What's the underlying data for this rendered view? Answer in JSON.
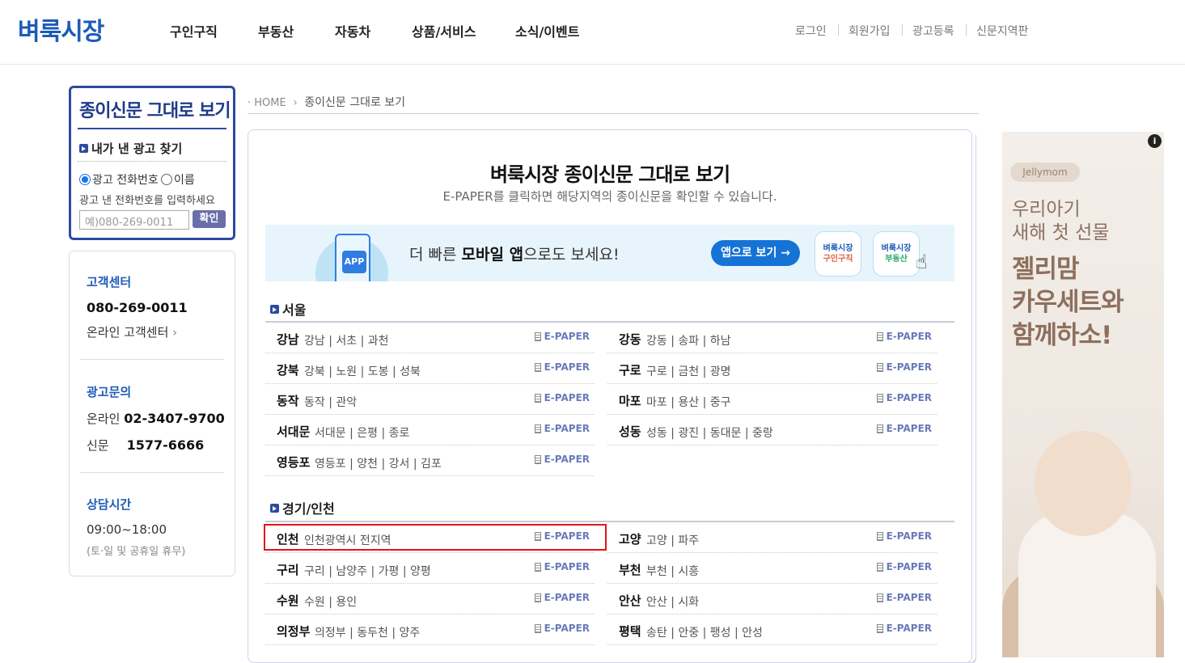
{
  "header": {
    "logo": "벼룩시장",
    "nav": [
      "구인구직",
      "부동산",
      "자동차",
      "상품/서비스",
      "소식/이벤트"
    ],
    "util": [
      "로그인",
      "회원가입",
      "광고등록",
      "신문지역판"
    ]
  },
  "paper_search": {
    "title": "종이신문 그대로 보기",
    "find_label": "내가 낸 광고 찾기",
    "radio_phone": "광고 전화번호",
    "radio_name": "이름",
    "hint": "광고 낸 전화번호를 입력하세요",
    "placeholder": "예)080-269-0011",
    "confirm": "확인"
  },
  "customer_center": {
    "cs_head": "고객센터",
    "cs_phone": "080-269-0011",
    "cs_online": "온라인 고객센터",
    "ad_head": "광고문의",
    "ad_online_label": "온라인",
    "ad_online_phone": "02-3407-9700",
    "ad_paper_label": "신문",
    "ad_paper_phone": "1577-6666",
    "hours_head": "상담시간",
    "hours": "09:00~18:00",
    "hours_note": "(토·일 및 공휴일 휴무)"
  },
  "breadcrumb": {
    "home": "HOME",
    "current": "종이신문 그대로 보기"
  },
  "main": {
    "title": "벼룩시장 종이신문 그대로 보기",
    "subtitle": "E-PAPER를 클릭하면 해당지역의 종이신문을 확인할 수 있습니다.",
    "banner": {
      "app_icon": "APP",
      "text_pre": "더 빠른 ",
      "text_bold": "모바일 앱",
      "text_post": "으로도 보세요!",
      "button": "앱으로 보기 →",
      "tile1_top": "벼룩시장",
      "tile1_bottom": "구인구직",
      "tile2_top": "벼룩시장",
      "tile2_bottom": "부동산"
    },
    "epaper_label": "E-PAPER",
    "regions": [
      {
        "name": "서울",
        "left": [
          {
            "name": "강남",
            "areas": "강남 | 서초 | 과천"
          },
          {
            "name": "강북",
            "areas": "강북 | 노원 | 도봉 | 성북"
          },
          {
            "name": "동작",
            "areas": "동작 | 관악"
          },
          {
            "name": "서대문",
            "areas": "서대문 | 은평 | 종로"
          },
          {
            "name": "영등포",
            "areas": "영등포 | 양천 | 강서 | 김포"
          }
        ],
        "right": [
          {
            "name": "강동",
            "areas": "강동 | 송파 | 하남"
          },
          {
            "name": "구로",
            "areas": "구로 | 금천 | 광명"
          },
          {
            "name": "마포",
            "areas": "마포 | 용산 | 중구"
          },
          {
            "name": "성동",
            "areas": "성동 | 광진 | 동대문 | 중랑"
          }
        ]
      },
      {
        "name": "경기/인천",
        "left": [
          {
            "name": "인천",
            "areas": "인천광역시 전지역"
          },
          {
            "name": "구리",
            "areas": "구리 | 남양주 | 가평 | 양평"
          },
          {
            "name": "수원",
            "areas": "수원 | 용인"
          },
          {
            "name": "의정부",
            "areas": "의정부 | 동두천 | 양주"
          }
        ],
        "right": [
          {
            "name": "고양",
            "areas": "고양 | 파주"
          },
          {
            "name": "부천",
            "areas": "부천 | 시흥"
          },
          {
            "name": "안산",
            "areas": "안산 | 시화"
          },
          {
            "name": "평택",
            "areas": "송탄 | 안중 | 팽성 | 안성"
          }
        ]
      }
    ]
  },
  "ad": {
    "info": "i",
    "brand": "Jellymom",
    "sub_line1": "우리아기",
    "sub_line2": "새해 첫 선물",
    "head_line1": "젤리맘",
    "head_line2": "카우세트와",
    "head_line3": "함께하소!"
  },
  "colors": {
    "brand_blue": "#1d5bb8",
    "panel_navy": "#2d4aa0",
    "highlight_red": "#e1141b",
    "app_button": "#1573d6"
  }
}
